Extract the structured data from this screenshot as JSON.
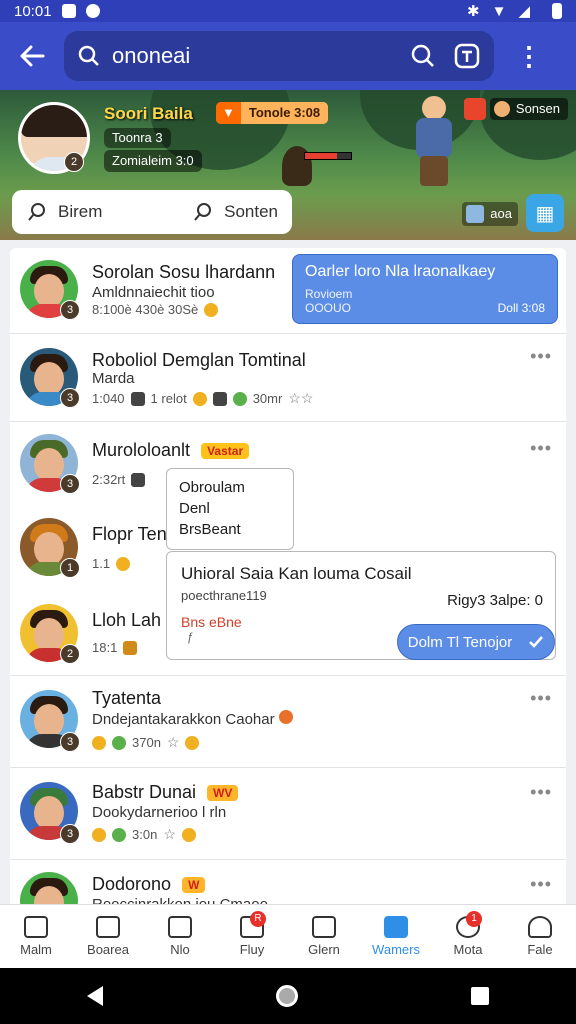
{
  "status_bar": {
    "time": "10:01"
  },
  "app_bar": {
    "search_query": "ononeai"
  },
  "banner": {
    "player_name": "Soori Baila",
    "chip1": "Toonra  3",
    "chip2": "Zomialeim 3:0",
    "tag_value": "Tonole 3:08",
    "corner_label": "Sonsen",
    "small_label": "aoa",
    "hp_fraction": 0.7,
    "search_left": "Birem",
    "search_right": "Sonten"
  },
  "rows": [
    {
      "title": "Sorolan Sosu lhardann",
      "sub": "Amldnnaiechit tioo",
      "meta": "8:100è  430è   30Sè",
      "level": "3",
      "card": {
        "title": "Oarler loro Nla lraonalkaey",
        "line1": "Rovioem",
        "line2": "OOOUO",
        "right": "Doll 3:08"
      }
    },
    {
      "title": "Roboliol Demglan Tomtinal",
      "sub": "Marda",
      "meta": "1:040",
      "meta2": "1 relot",
      "meta3": "30mr",
      "level": "3"
    },
    {
      "title": "Murololoanlt",
      "badge": "Vastar",
      "meta": "2:32rt",
      "level": "3"
    },
    {
      "title": "Flopr Ten",
      "meta": "1.1",
      "level": "1"
    },
    {
      "title": "Lloh Lah",
      "meta": "18:1",
      "level": "2"
    },
    {
      "title": "Tyatenta",
      "sub": "Dndejantakarakkon Caohar",
      "meta": "370n",
      "level": "3"
    },
    {
      "title": "Babstr Dunai",
      "badge": "WV",
      "sub": "Dookydarnerioo l rln",
      "meta": "3:0n",
      "level": "3"
    },
    {
      "title": "Dodorono",
      "badge": "W",
      "sub": "Rooccinrakkon iou Cmaoo"
    }
  ],
  "popup_a": {
    "line1": "Obroulam",
    "line2": "Denl",
    "line3": "BrsBeant"
  },
  "popup_b": {
    "title": "Uhioral Saia Kan louma Cosail",
    "sub": "poecthrane119",
    "right": "Rigy3 3alpe: 0",
    "red": "Bns eBne",
    "glyph": "ƒ",
    "button": "Dolm Tl Tenojor"
  },
  "bottom_nav": [
    {
      "label": "Malm"
    },
    {
      "label": "Boarea"
    },
    {
      "label": "Nlo"
    },
    {
      "label": "Fluy",
      "notif": "R"
    },
    {
      "label": "Glern"
    },
    {
      "label": "Wamers",
      "active": true
    },
    {
      "label": "Mota",
      "notif": "1"
    },
    {
      "label": "Fale"
    }
  ]
}
